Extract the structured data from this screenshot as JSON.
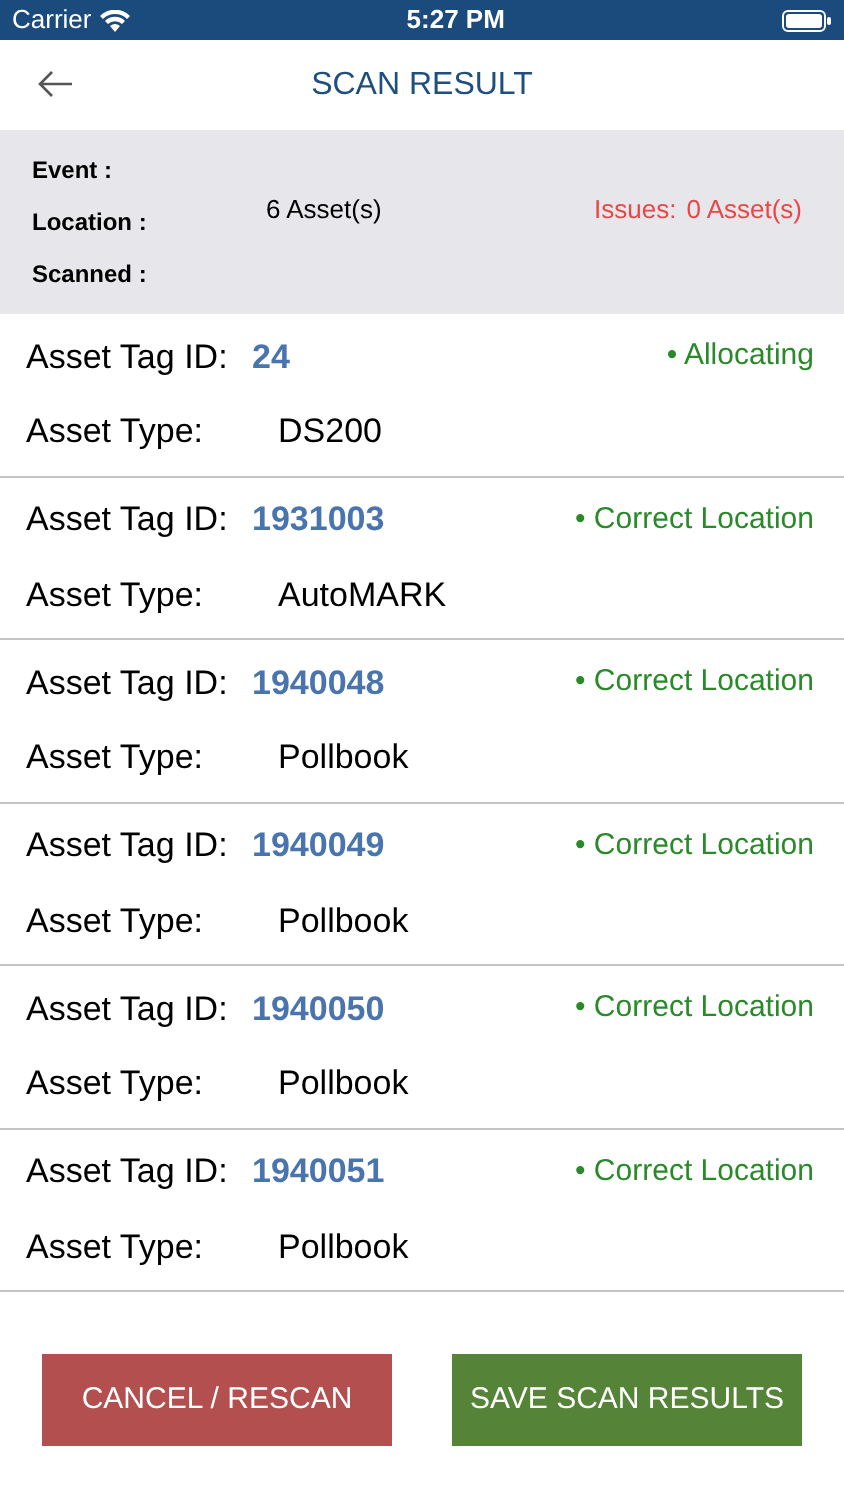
{
  "status_bar": {
    "carrier": "Carrier",
    "time": "5:27 PM"
  },
  "header": {
    "title": "SCAN RESULT"
  },
  "summary": {
    "event_label": "Event :",
    "location_label": "Location :",
    "scanned_label": "Scanned :",
    "scanned_value": "6 Asset(s)",
    "issues_label": "Issues:",
    "issues_value": "0 Asset(s)"
  },
  "assets": [
    {
      "tag_label": "Asset Tag ID:",
      "tag": "24",
      "status": "• Allocating",
      "type_label": "Asset Type:",
      "type": "DS200"
    },
    {
      "tag_label": "Asset Tag ID:",
      "tag": "1931003",
      "status": "• Correct Location",
      "type_label": "Asset Type:",
      "type": "AutoMARK"
    },
    {
      "tag_label": "Asset Tag ID:",
      "tag": "1940048",
      "status": "• Correct Location",
      "type_label": "Asset Type:",
      "type": "Pollbook"
    },
    {
      "tag_label": "Asset Tag ID:",
      "tag": "1940049",
      "status": "• Correct Location",
      "type_label": "Asset Type:",
      "type": "Pollbook"
    },
    {
      "tag_label": "Asset Tag ID:",
      "tag": "1940050",
      "status": "• Correct Location",
      "type_label": "Asset Type:",
      "type": "Pollbook"
    },
    {
      "tag_label": "Asset Tag ID:",
      "tag": "1940051",
      "status": "• Correct Location",
      "type_label": "Asset Type:",
      "type": "Pollbook"
    }
  ],
  "buttons": {
    "cancel": "CANCEL / RESCAN",
    "save": "SAVE SCAN RESULTS"
  }
}
